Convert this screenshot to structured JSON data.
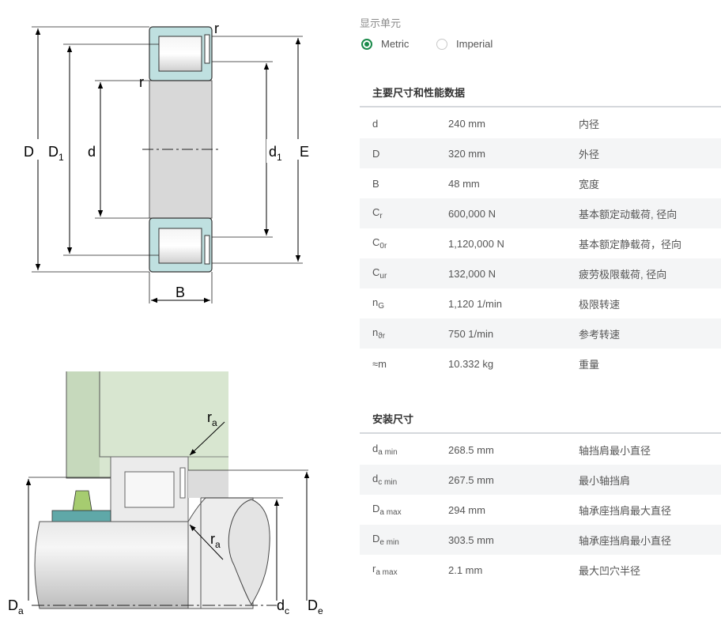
{
  "drawing": {
    "top_labels": {
      "D": "D",
      "D1": "D",
      "D1_sub": "1",
      "d": "d",
      "d1": "d",
      "d1_sub": "1",
      "E": "E",
      "r_top": "r",
      "r_left": "r",
      "B": "B"
    },
    "bottom_labels": {
      "ra_top": "r",
      "ra_top_sub": "a",
      "ra_bottom": "r",
      "ra_bottom_sub": "a",
      "Da": "D",
      "Da_sub": "a",
      "dc": "d",
      "dc_sub": "c",
      "De": "D",
      "De_sub": "e"
    }
  },
  "units": {
    "title": "显示单元",
    "options": [
      {
        "label": "Metric",
        "selected": true
      },
      {
        "label": "Imperial",
        "selected": false
      }
    ]
  },
  "main_dims": {
    "title": "主要尺寸和性能数据",
    "rows": [
      {
        "sym": "d",
        "sub": "",
        "value": "240 mm",
        "desc": "内径"
      },
      {
        "sym": "D",
        "sub": "",
        "value": "320 mm",
        "desc": "外径"
      },
      {
        "sym": "B",
        "sub": "",
        "value": "48 mm",
        "desc": "宽度"
      },
      {
        "sym": "C",
        "sub": "r",
        "value": "600,000 N",
        "desc": "基本额定动载荷, 径向"
      },
      {
        "sym": "C",
        "sub": "0r",
        "value": "1,120,000 N",
        "desc": "基本额定静载荷，径向"
      },
      {
        "sym": "C",
        "sub": "ur",
        "value": "132,000 N",
        "desc": "疲劳极限载荷, 径向"
      },
      {
        "sym": "n",
        "sub": "G",
        "value": "1,120 1/min",
        "desc": "极限转速"
      },
      {
        "sym": "n",
        "sub": "ϑr",
        "value": "750 1/min",
        "desc": "参考转速"
      },
      {
        "sym": "≈m",
        "sub": "",
        "value": "10.332 kg",
        "desc": "重量"
      }
    ]
  },
  "mount_dims": {
    "title": "安装尺寸",
    "rows": [
      {
        "sym": "d",
        "sub": "a min",
        "value": "268.5 mm",
        "desc": "轴挡肩最小直径"
      },
      {
        "sym": "d",
        "sub": "c min",
        "value": "267.5 mm",
        "desc": "最小轴挡肩"
      },
      {
        "sym": "D",
        "sub": "a max",
        "value": "294 mm",
        "desc": "轴承座挡肩最大直径"
      },
      {
        "sym": "D",
        "sub": "e min",
        "value": "303.5 mm",
        "desc": "轴承座挡肩最小直径"
      },
      {
        "sym": "r",
        "sub": "a max",
        "value": "2.1 mm",
        "desc": "最大凹穴半径"
      }
    ]
  },
  "colors": {
    "accent": "#1a8a4a",
    "ring_fill": "#bfe0e0",
    "bore_fill": "#d8d8d8",
    "housing_fill": "#c8dcbf"
  }
}
